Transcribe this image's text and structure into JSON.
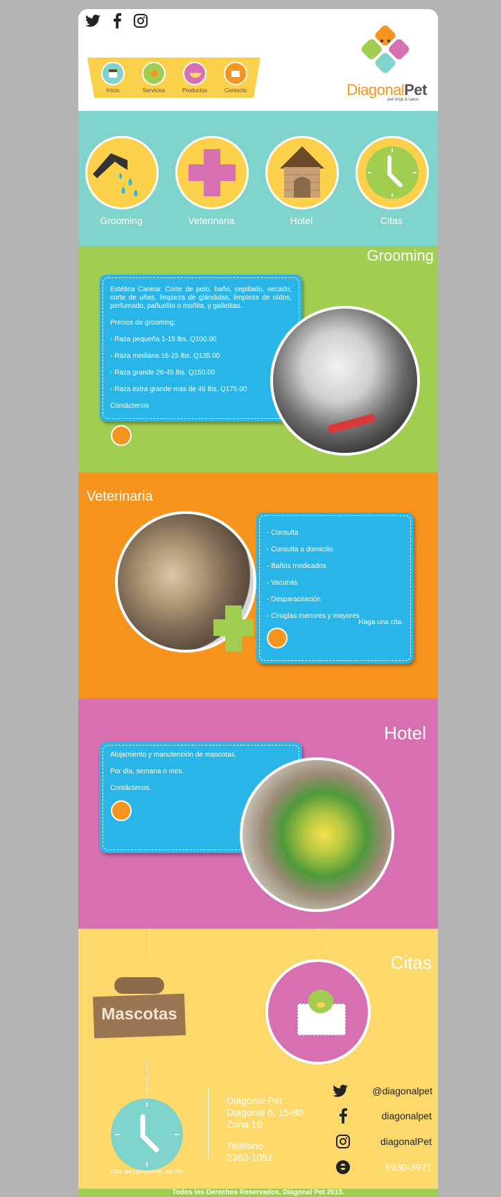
{
  "header": {
    "nav": [
      {
        "label": "Inicio",
        "color": "#7ed4cb"
      },
      {
        "label": "Servicios",
        "color": "#a1ce50"
      },
      {
        "label": "Productos",
        "color": "#d770b0"
      },
      {
        "label": "Contacto",
        "color": "#f7941d"
      }
    ],
    "logo": {
      "word1": "Diagonal",
      "word2": "Pet",
      "tagline": "pet shop & salon"
    },
    "social_icons": [
      "twitter-icon",
      "facebook-icon",
      "instagram-icon"
    ]
  },
  "services": [
    {
      "label": "Grooming",
      "icon": "shower-icon"
    },
    {
      "label": "Veterinaria",
      "icon": "cross-icon"
    },
    {
      "label": "Hotel",
      "icon": "doghouse-icon"
    },
    {
      "label": "Citas",
      "icon": "clock-icon"
    }
  ],
  "grooming": {
    "title": "Grooming",
    "paragraphs": [
      "Estética Canina: Corte de pelo, baño, cepillado, secado, corte de uñas, limpieza de glándulas, limpieza de oídos, perfumado, pañuelito o moñita, y galletitas.",
      "Precios de grooming:",
      "- Raza pequeña 1-15 lbs. Q100.00",
      "- Raza mediana 16-25 lbs. Q135.00",
      "- Raza grande 26-45 lbs. Q150.00",
      "- Raza extra grande mas de 46 lbs. Q175.00",
      "Contáctenos"
    ]
  },
  "veterinaria": {
    "title": "Veterinaria",
    "items": [
      "- Consulta",
      "- Consulta a domicilio",
      "- Baños medicados",
      "- Vacunas",
      "- Desparacitación",
      "- Cirugías menores y mayores"
    ],
    "cta": "Haga una cita."
  },
  "hotel": {
    "title": "Hotel",
    "paragraphs": [
      "Alojamiento y manutención de mascotas.",
      "Por día, semana o mes.",
      "Contáctenos."
    ]
  },
  "citas": {
    "title": "Citas",
    "sign": "Mascotas",
    "clock_caption": "Click para programar una cita",
    "address": [
      "Diagonal Pet",
      "Diagonal 6, 15-80",
      "Zona 10"
    ],
    "phone_label": "Teléfono",
    "phone": "2363-1051",
    "social": [
      {
        "icon": "twitter-icon",
        "text": "@diagonalpet"
      },
      {
        "icon": "facebook-icon",
        "text": "diagonalpet"
      },
      {
        "icon": "instagram-icon",
        "text": "diagonalPet"
      },
      {
        "icon": "bbm-icon",
        "text": "5930-3971"
      }
    ]
  },
  "footer": {
    "text": "Todos los Derechos Reservados, Diagonal Pet 2013."
  }
}
